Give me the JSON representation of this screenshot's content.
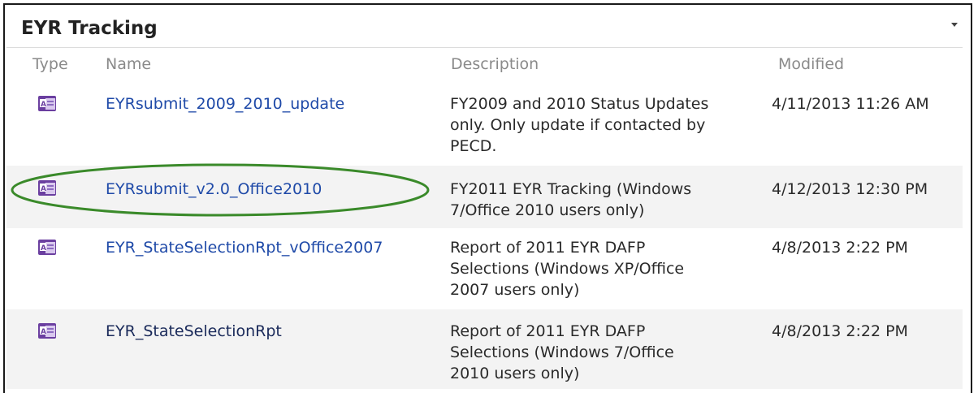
{
  "webpart": {
    "title": "EYR Tracking"
  },
  "columns": {
    "type": "Type",
    "name": "Name",
    "description": "Description",
    "modified": "Modified"
  },
  "rows": [
    {
      "name": "EYRsubmit_2009_2010_update",
      "description_lines": [
        "FY2009 and 2010 Status Updates",
        "only.  Only update if contacted by",
        "PECD."
      ],
      "modified": "4/11/2013 11:26 AM",
      "icon": "access-database-icon"
    },
    {
      "name": "EYRsubmit_v2.0_Office2010",
      "description_lines": [
        "FY2011 EYR Tracking (Windows",
        "7/Office 2010 users only)"
      ],
      "modified": "4/12/2013 12:30 PM",
      "icon": "access-database-icon",
      "highlighted": true
    },
    {
      "name": "EYR_StateSelectionRpt_vOffice2007",
      "description_lines": [
        "Report of 2011 EYR DAFP",
        "Selections (Windows XP/Office",
        "2007 users only)"
      ],
      "modified": "4/8/2013 2:22 PM",
      "icon": "access-database-icon"
    },
    {
      "name": "EYR_StateSelectionRpt",
      "description_lines": [
        "Report of 2011 EYR DAFP",
        "Selections (Windows 7/Office",
        "2010 users only)"
      ],
      "modified": "4/8/2013 2:22 PM",
      "icon": "access-database-icon"
    }
  ],
  "colors": {
    "link": "#1f4aa8",
    "highlight_ellipse": "#3a8a2a",
    "alt_row": "#f3f3f3"
  }
}
